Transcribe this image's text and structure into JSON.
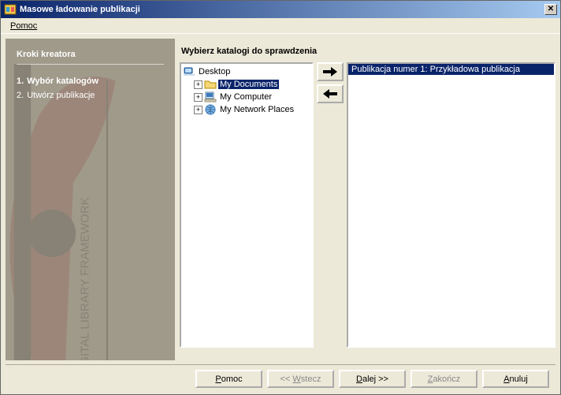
{
  "window": {
    "title": "Masowe ładowanie publikacji"
  },
  "menubar": {
    "help": "Pomoc"
  },
  "sidebar": {
    "title": "Kroki kreatora",
    "steps": [
      {
        "num": "1.",
        "label": "Wybór katalogów",
        "active": true
      },
      {
        "num": "2.",
        "label": "Utwórz publikacje",
        "active": false
      }
    ]
  },
  "content": {
    "title": "Wybierz katalogi do sprawdzenia"
  },
  "tree": {
    "root": {
      "label": "Desktop",
      "icon": "desktop"
    },
    "children": [
      {
        "label": "My Documents",
        "icon": "folder",
        "selected": true,
        "expandable": true
      },
      {
        "label": "My Computer",
        "icon": "computer",
        "selected": false,
        "expandable": true
      },
      {
        "label": "My Network Places",
        "icon": "network",
        "selected": false,
        "expandable": true
      }
    ]
  },
  "arrows": {
    "right": "➔",
    "left": "←"
  },
  "list": {
    "items": [
      {
        "label": "Publikacja numer 1: Przykładowa publikacja",
        "selected": true
      }
    ]
  },
  "buttons": {
    "help": "Pomoc",
    "back": "<< Wstecz",
    "next": "Dalej >>",
    "finish": "Zakończ",
    "cancel": "Anuluj"
  }
}
